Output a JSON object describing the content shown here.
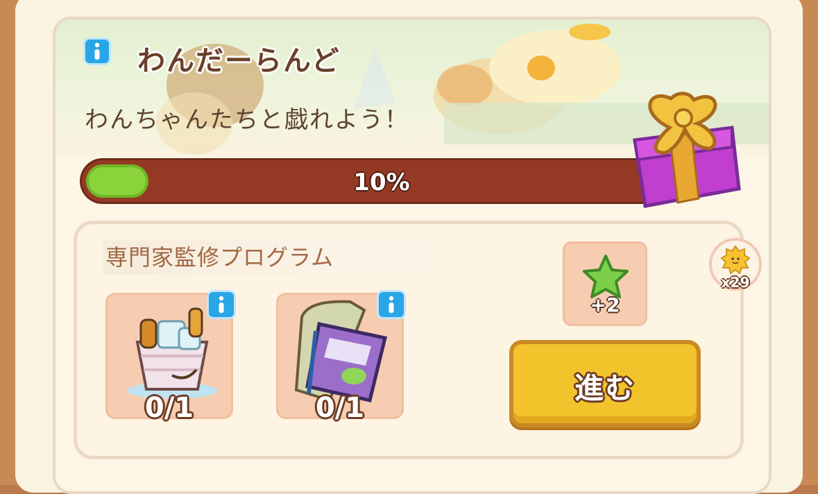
{
  "event": {
    "title": "わんだーらんど",
    "subtitle": "わんちゃんたちと戯れよう！",
    "progress": {
      "percent": 10,
      "label": "10%"
    },
    "reward_icon": "gift-box-icon"
  },
  "program": {
    "label": "専門家監修プログラム",
    "items": [
      {
        "icon": "ice-bucket-drinks-icon",
        "count": "0/1"
      },
      {
        "icon": "sketchbook-icon",
        "count": "0/1"
      }
    ],
    "reward": {
      "icon": "green-star-icon",
      "qty": "+2"
    },
    "go_label": "進む"
  },
  "currency": {
    "icon": "sun-coin-icon",
    "qty": "x29"
  },
  "colors": {
    "progress_track": "#943a24",
    "progress_fill": "#8bd33b",
    "button": "#f3c32c",
    "info": "#2aa6e6"
  }
}
